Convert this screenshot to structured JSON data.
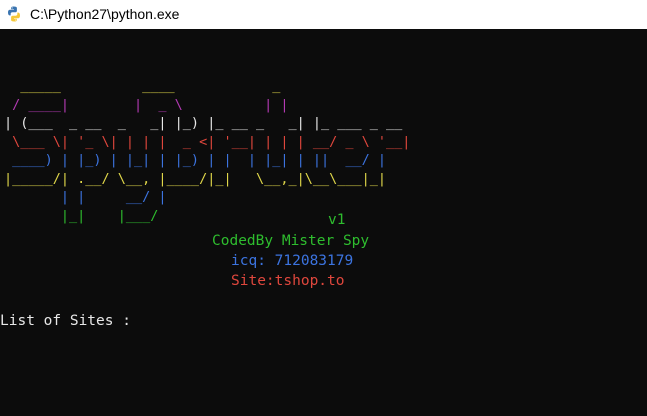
{
  "window": {
    "title": "C:\\Python27\\python.exe",
    "icon": "python-icon"
  },
  "banner": {
    "lines": [
      {
        "color": "yellow",
        "text": "  _____          ____            _"
      },
      {
        "color": "magenta",
        "text": " / ____|        |  _ \\          | |"
      },
      {
        "color": "white",
        "text": "| (___  _ __  _   _| |_) |_ __ _   _| |_ ___ _ __"
      },
      {
        "color": "red",
        "text": " \\___ \\| '_ \\| | | |  _ <| '__| | | | __/ _ \\ '__|"
      },
      {
        "color": "blue",
        "text": " ____) | |_) | |_| | |_) | |  | |_| | ||  __/ |"
      },
      {
        "color": "yellow",
        "text": "|_____/| .__/ \\__, |____/|_|   \\__,_|\\__\\___|_|"
      },
      {
        "color": "blue",
        "text": "       | |     __/ |"
      },
      {
        "color": "green",
        "text": "       |_|    |___/"
      }
    ]
  },
  "info": {
    "version": "v1",
    "coded_by": "CodedBy Mister Spy",
    "icq": "icq: 712083179",
    "site": "Site:tshop.to"
  },
  "prompt": {
    "text": "List of Sites :"
  },
  "colors": {
    "background": "#0c0c0c",
    "yellow": "#e0d74a",
    "magenta": "#b33ab3",
    "white": "#e8e8e8",
    "red": "#e0473d",
    "blue": "#3c74e0",
    "green": "#2ebd2e"
  }
}
